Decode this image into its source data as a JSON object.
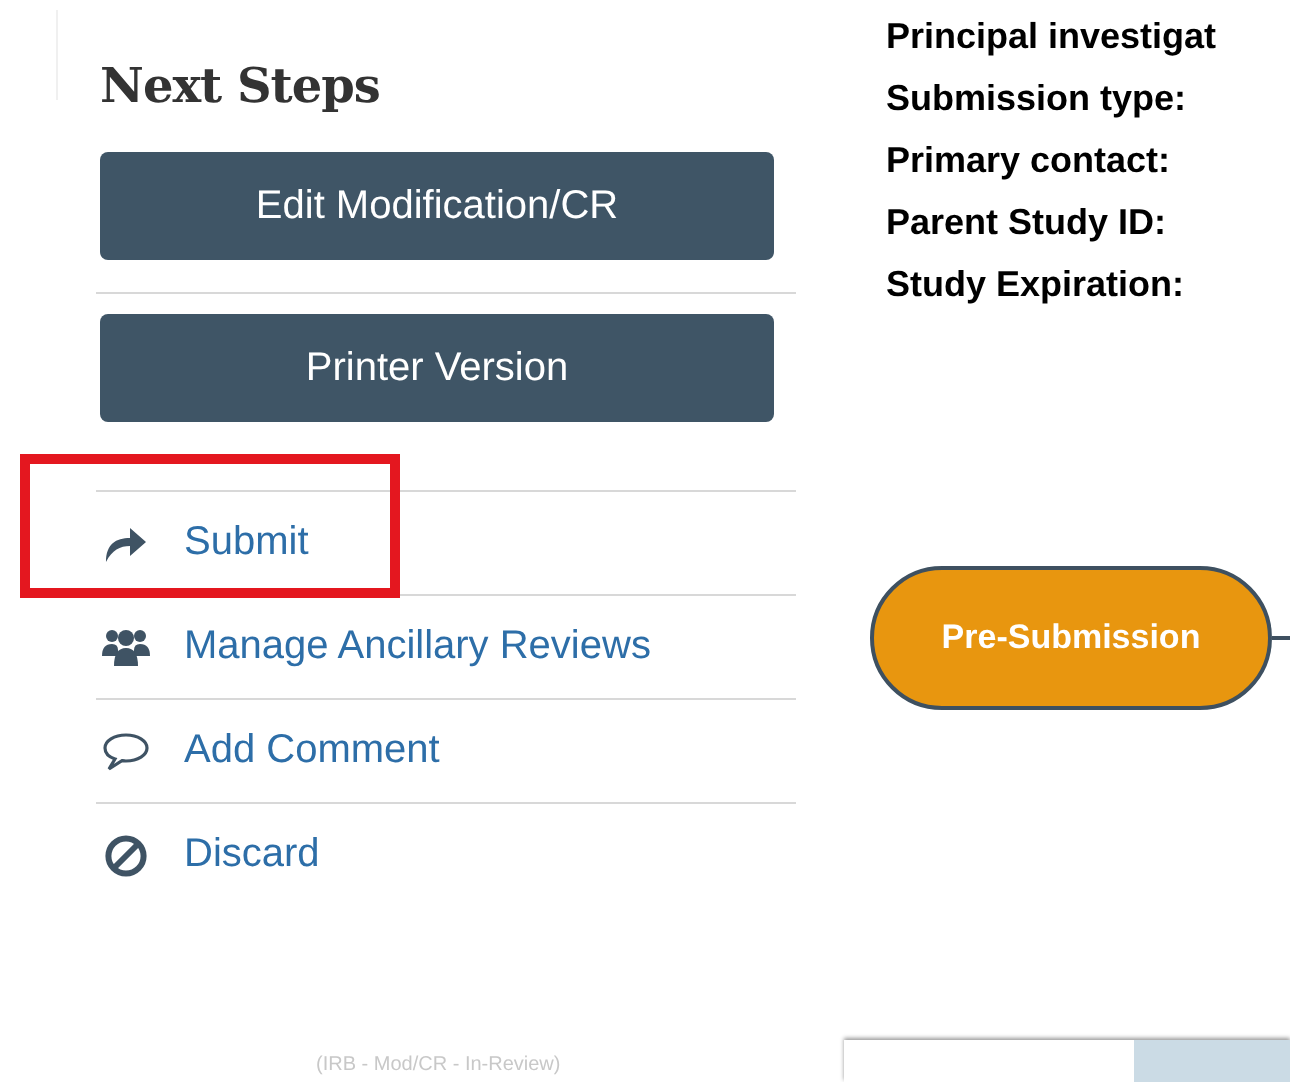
{
  "sidebar": {
    "title": "Next Steps",
    "buttons": [
      "Edit Modification/CR",
      "Printer Version"
    ],
    "actions": [
      {
        "label": "Submit",
        "kind": "share",
        "highlighted": true
      },
      {
        "label": "Manage Ancillary Reviews",
        "kind": "users",
        "highlighted": false
      },
      {
        "label": "Add Comment",
        "kind": "comment",
        "highlighted": false
      },
      {
        "label": "Discard",
        "kind": "ban",
        "highlighted": false
      }
    ],
    "footer": "(IRB - Mod/CR - In-Review)"
  },
  "details": {
    "fields": [
      "Principal investigat",
      "Submission type:",
      "Primary contact:",
      "Parent Study ID:",
      "Study Expiration:"
    ]
  },
  "workflow": {
    "state": "Pre-Submission"
  },
  "tabs": [
    {
      "selected": true
    },
    {
      "selected": false
    }
  ]
}
